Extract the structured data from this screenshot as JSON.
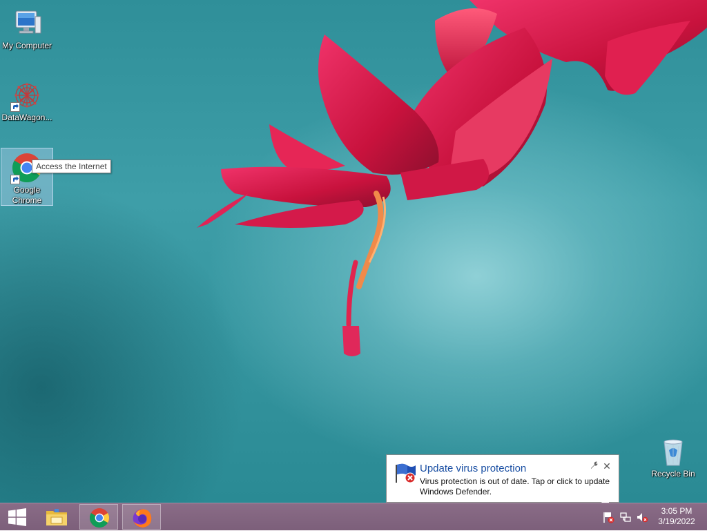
{
  "desktop": {
    "icons": [
      {
        "label": "My Computer"
      },
      {
        "label": "DataWagon..."
      },
      {
        "label": "Google Chrome"
      },
      {
        "label": "Recycle Bin"
      }
    ],
    "tooltip": "Access the Internet"
  },
  "notification": {
    "title": "Update virus protection",
    "body": "Virus protection is out of date. Tap or click to update Windows Defender.",
    "icon": "action-center-flag-error-icon",
    "buttons": {
      "settings": "wrench-icon",
      "close": "close-icon"
    }
  },
  "taskbar": {
    "start_icon": "windows-logo-icon",
    "pinned": [
      {
        "icon": "file-explorer-icon"
      },
      {
        "icon": "chrome-icon"
      },
      {
        "icon": "firefox-icon"
      }
    ],
    "tray": [
      {
        "icon": "action-center-flag-error-icon"
      },
      {
        "icon": "network-icon"
      },
      {
        "icon": "speaker-muted-icon"
      }
    ],
    "clock": {
      "time": "3:05 PM",
      "date": "3/19/2022"
    }
  },
  "colors": {
    "taskbar": "#7c5f7a",
    "desktop": "#3e9ea8",
    "balloon_title": "#1a4fa3",
    "flower": "#d81c4c"
  }
}
